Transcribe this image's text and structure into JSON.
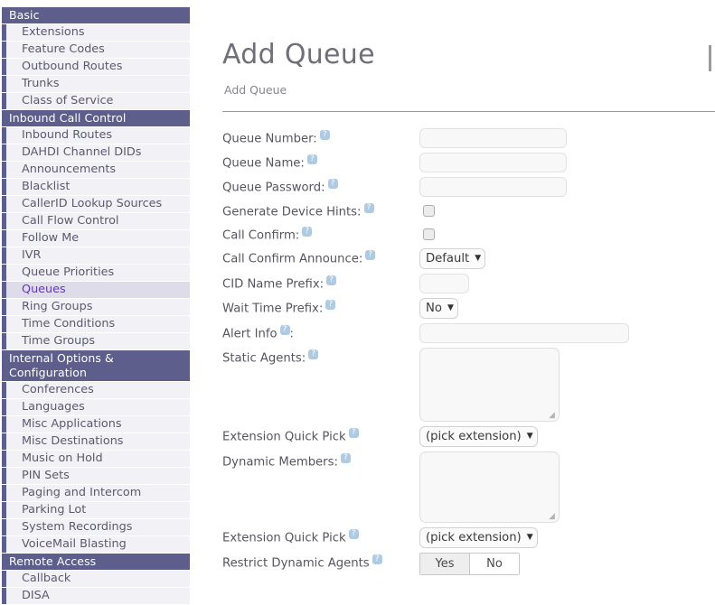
{
  "sidebar": {
    "groups": [
      {
        "header": "Basic",
        "items": [
          {
            "label": "Extensions",
            "active": false
          },
          {
            "label": "Feature Codes",
            "active": false
          },
          {
            "label": "Outbound Routes",
            "active": false
          },
          {
            "label": "Trunks",
            "active": false
          },
          {
            "label": "Class of Service",
            "active": false
          }
        ]
      },
      {
        "header": "Inbound Call Control",
        "items": [
          {
            "label": "Inbound Routes",
            "active": false
          },
          {
            "label": "DAHDI Channel DIDs",
            "active": false
          },
          {
            "label": "Announcements",
            "active": false
          },
          {
            "label": "Blacklist",
            "active": false
          },
          {
            "label": "CallerID Lookup Sources",
            "active": false
          },
          {
            "label": "Call Flow Control",
            "active": false
          },
          {
            "label": "Follow Me",
            "active": false
          },
          {
            "label": "IVR",
            "active": false
          },
          {
            "label": "Queue Priorities",
            "active": false
          },
          {
            "label": "Queues",
            "active": true
          },
          {
            "label": "Ring Groups",
            "active": false
          },
          {
            "label": "Time Conditions",
            "active": false
          },
          {
            "label": "Time Groups",
            "active": false
          }
        ]
      },
      {
        "header": "Internal Options & Configuration",
        "items": [
          {
            "label": "Conferences",
            "active": false
          },
          {
            "label": "Languages",
            "active": false
          },
          {
            "label": "Misc Applications",
            "active": false
          },
          {
            "label": "Misc Destinations",
            "active": false
          },
          {
            "label": "Music on Hold",
            "active": false
          },
          {
            "label": "PIN Sets",
            "active": false
          },
          {
            "label": "Paging and Intercom",
            "active": false
          },
          {
            "label": "Parking Lot",
            "active": false
          },
          {
            "label": "System Recordings",
            "active": false
          },
          {
            "label": "VoiceMail Blasting",
            "active": false
          }
        ]
      },
      {
        "header": "Remote Access",
        "items": [
          {
            "label": "Callback",
            "active": false
          },
          {
            "label": "DISA",
            "active": false
          }
        ]
      }
    ]
  },
  "main": {
    "title": "Add Queue",
    "breadcrumb": "Add Queue",
    "help_glyph": "?",
    "fields": [
      {
        "id": "queue_number",
        "label": "Queue Number:",
        "control": "text",
        "value": "",
        "width": "w-med"
      },
      {
        "id": "queue_name",
        "label": "Queue Name:",
        "control": "text",
        "value": "",
        "width": "w-med"
      },
      {
        "id": "queue_password",
        "label": "Queue Password:",
        "control": "text",
        "value": "",
        "width": "w-med"
      },
      {
        "id": "generate_hints",
        "label": "Generate Device Hints:",
        "control": "checkbox",
        "checked": false
      },
      {
        "id": "call_confirm",
        "label": "Call Confirm:",
        "control": "checkbox",
        "checked": false
      },
      {
        "id": "confirm_announce",
        "label": "Call Confirm Announce:",
        "control": "select",
        "value": "Default"
      },
      {
        "id": "cid_name_prefix",
        "label": "CID Name Prefix:",
        "control": "text",
        "value": "",
        "width": "w-small"
      },
      {
        "id": "wait_time_prefix",
        "label": "Wait Time Prefix:",
        "control": "select",
        "value": "No"
      },
      {
        "id": "alert_info",
        "label": "Alert Info",
        "label_suffix": ":",
        "help_before_colon": true,
        "control": "text",
        "value": "",
        "width": "w-wide"
      },
      {
        "id": "static_agents",
        "label": "Static Agents:",
        "control": "textarea",
        "value": "",
        "size": "h-static"
      },
      {
        "id": "ext_quick_pick_1",
        "label": "Extension Quick Pick",
        "control": "select",
        "value": "(pick extension)"
      },
      {
        "id": "dynamic_members",
        "label": "Dynamic Members:",
        "control": "textarea",
        "value": "",
        "size": "h-dyn"
      },
      {
        "id": "ext_quick_pick_2",
        "label": "Extension Quick Pick",
        "control": "select",
        "value": "(pick extension)"
      },
      {
        "id": "restrict_dynamic",
        "label": "Restrict Dynamic Agents",
        "control": "toggle",
        "options": [
          "Yes",
          "No"
        ],
        "selected": "Yes"
      }
    ],
    "select_arrow": "▼",
    "resize_grip": "◢"
  }
}
